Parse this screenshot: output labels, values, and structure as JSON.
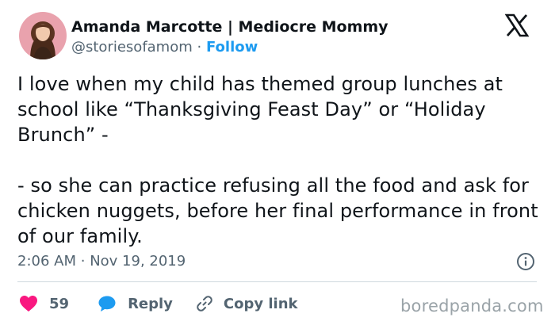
{
  "author": {
    "name": "Amanda Marcotte | Mediocre Mommy",
    "handle": "@storiesofamom",
    "separator": "·",
    "follow_label": "Follow"
  },
  "tweet": {
    "text": "I love when my child has themed group lunches at school like “Thanksgiving Feast Day” or “Holiday Brunch” -\n\n- so she can practice refusing all the food and ask for chicken nuggets, before her final performance in front of our family.",
    "time": "2:06 AM",
    "separator": "·",
    "date": "Nov 19, 2019"
  },
  "actions": {
    "likes": "59",
    "reply_label": "Reply",
    "copy_link_label": "Copy link"
  },
  "watermark": "boredpanda.com",
  "icons": {
    "logo": "x-logo-icon",
    "info": "info-icon",
    "like": "heart-icon",
    "reply": "speech-bubble-icon",
    "copy": "link-icon"
  },
  "colors": {
    "text": "#0f1419",
    "secondary": "#536471",
    "accent": "#1d9bf0",
    "like": "#f91880",
    "divider": "#cfd9de",
    "watermark": "#9aa3a8"
  }
}
